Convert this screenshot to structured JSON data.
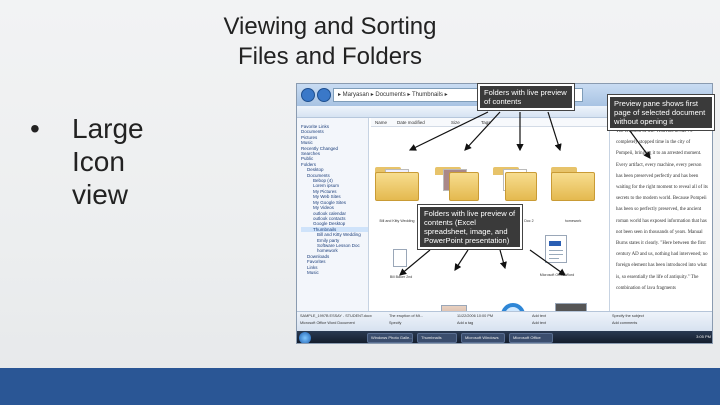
{
  "slide": {
    "title_line1": "Viewing and Sorting",
    "title_line2": "Files and Folders",
    "bullet_symbol": "•",
    "bullet_text": "Large Icon view"
  },
  "explorer": {
    "address": "▸ Maryasan ▸ Documents ▸ Thumbnails ▸",
    "columns": [
      "Name",
      "Date modified",
      "Size",
      "Tags"
    ],
    "nav_items": [
      {
        "label": "Favorite Links",
        "level": 0
      },
      {
        "label": "Documents",
        "level": 0
      },
      {
        "label": "Pictures",
        "level": 0
      },
      {
        "label": "Music",
        "level": 0
      },
      {
        "label": "Recently Changed",
        "level": 0
      },
      {
        "label": "Searches",
        "level": 0
      },
      {
        "label": "Public",
        "level": 0
      },
      {
        "label": "Folders",
        "level": 0
      },
      {
        "label": "Desktop",
        "level": 1
      },
      {
        "label": "Documents",
        "level": 1
      },
      {
        "label": "Bebop (4)",
        "level": 2
      },
      {
        "label": "Lorem ipsum",
        "level": 2
      },
      {
        "label": "My Pictures",
        "level": 2
      },
      {
        "label": "My Web Sites",
        "level": 2
      },
      {
        "label": "My Google Sites",
        "level": 2
      },
      {
        "label": "My Videos",
        "level": 2
      },
      {
        "label": "outlook calendar",
        "level": 2
      },
      {
        "label": "outlook contacts",
        "level": 2
      },
      {
        "label": "Google Desktop",
        "level": 2
      },
      {
        "label": "Thumbnails",
        "level": 2
      },
      {
        "label": "Bill and Kitty Wedding",
        "level": 3
      },
      {
        "label": "Emily party",
        "level": 3
      },
      {
        "label": "Software Lesson Doc",
        "level": 3
      },
      {
        "label": "homework",
        "level": 3
      },
      {
        "label": "Downloads",
        "level": 1
      },
      {
        "label": "Favorites",
        "level": 1
      },
      {
        "label": "Links",
        "level": 1
      },
      {
        "label": "Music",
        "level": 1
      }
    ],
    "folders": [
      "Bill and Kitty Wedding",
      "Emily party",
      "Software Lesson Doc 2",
      "homework"
    ],
    "files": [
      "Bill Bauer 2nd",
      "Microsoft Office Word",
      "Bike",
      "Spreadsheet Bill",
      "Internet",
      "Using_File_Tutor_ifr_file_C"
    ],
    "preview_text": "The eruption of Mt. Vesuvius in AD 79 completely stopped time in the city of Pompeii, bringing it to an arrested moment. Every artifact, every machine, every person has been preserved perfectly and has been waiting for the right moment to reveal all of its secrets to the modern world. Because Pompeii has been so perfectly preserved, the ancient roman world has exposed information that has not been seen in thousands of years. Manual Burns states it clearly. \"Here between the first century AD and us, nothing had intervened; no foreign element has been introduced into what is, so essentially the life of antiquity.\" The combination of lava fragments",
    "details": {
      "file_name": "SAMPLE_1997B ESSAY - STUDENT.docx",
      "file_type": "Microsoft Office Word Document",
      "title": "The eruption of Mt...",
      "authors": "Specify",
      "tags": "Add a tag",
      "date_modified": "11/22/2006 10:00 PM",
      "size": "26.4 KB",
      "pages": "Add a tag",
      "category": "Add a category",
      "status": "Add text",
      "content_type": "Add text",
      "pages_count": "14",
      "subject": "Specify the subject",
      "comments": "Add comments",
      "status_word_count": "16,0"
    },
    "taskbar": {
      "tasks": [
        "Windows Photo Galle...",
        "Thumbnails",
        "Microsoft Windows",
        "Microsoft Office"
      ],
      "clock": "3:05 PM"
    }
  },
  "callouts": {
    "folders_live_preview": "Folders with live preview of contents",
    "preview_pane": "Preview pane shows first page of selected document without opening it",
    "files_live_preview": "Folders with live preview of contents (Excel spreadsheet, image, and PowerPoint presentation)"
  },
  "colors": {
    "bottom_bar": "#2a5695",
    "callout_bg": "#3a3a3a",
    "folder": "#e4b94f"
  }
}
